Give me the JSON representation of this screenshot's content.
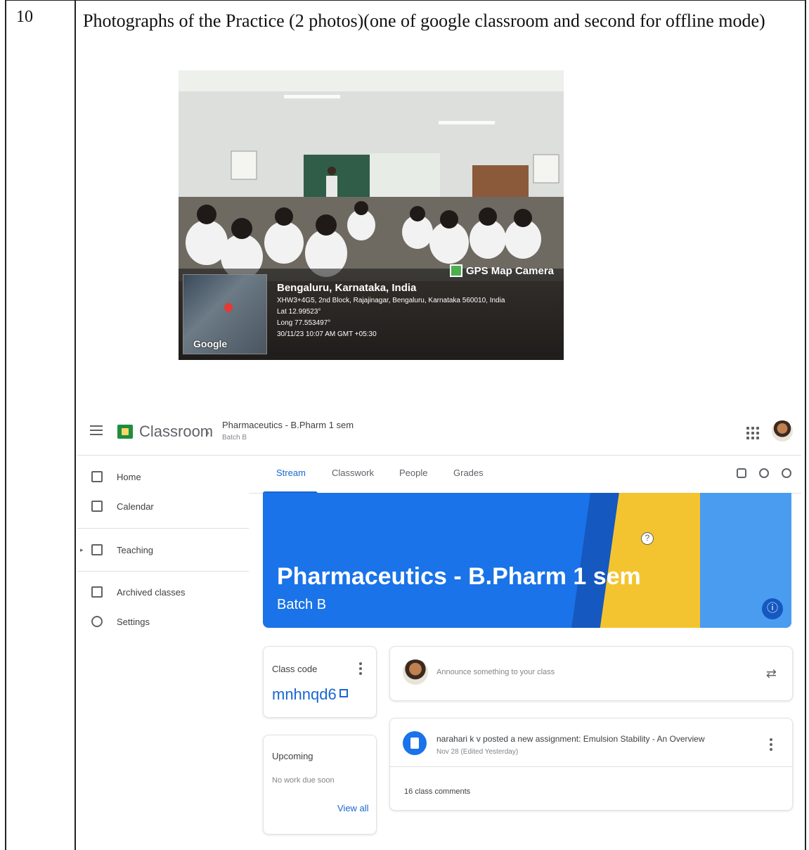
{
  "row": {
    "number": "10",
    "heading": "Photographs of the Practice (2 photos)(one of google classroom and second for offline mode)"
  },
  "photo": {
    "gps_app": "GPS Map Camera",
    "location": "Bengaluru, Karnataka, India",
    "address": "XHW3+4G5, 2nd Block, Rajajinagar, Bengaluru, Karnataka 560010, India",
    "lat": "Lat 12.99523°",
    "long": "Long 77.553497°",
    "datetime": "30/11/23 10:07 AM GMT +05:30",
    "map_logo": "Google"
  },
  "classroom": {
    "app_name": "Classroom",
    "breadcrumb_sep": "›",
    "class_title": "Pharmaceutics - B.Pharm 1 sem",
    "class_section": "Batch B",
    "sidebar": [
      {
        "label": "Home",
        "icon": "home-icon"
      },
      {
        "label": "Calendar",
        "icon": "calendar-icon"
      },
      {
        "label": "Teaching",
        "icon": "people-icon"
      },
      {
        "label": "Archived classes",
        "icon": "archive-icon"
      },
      {
        "label": "Settings",
        "icon": "gear-icon"
      }
    ],
    "tabs": [
      "Stream",
      "Classwork",
      "People",
      "Grades"
    ],
    "banner": {
      "title": "Pharmaceutics - B.Pharm 1 sem",
      "subtitle": "Batch B",
      "info_icon": "ⓘ"
    },
    "class_code": {
      "label": "Class code",
      "value": "mnhnqd6"
    },
    "upcoming": {
      "title": "Upcoming",
      "empty": "No work due soon",
      "link": "View all"
    },
    "announce": {
      "placeholder": "Announce something to your class"
    },
    "post": {
      "title": "narahari k v posted a new assignment: Emulsion Stability - An Overview",
      "date": "Nov 28 (Edited Yesterday)",
      "comments": "16 class comments"
    },
    "colors": {
      "accent": "#1967d2",
      "banner": "#1a73e8",
      "logo": "#1e8e3e"
    }
  }
}
